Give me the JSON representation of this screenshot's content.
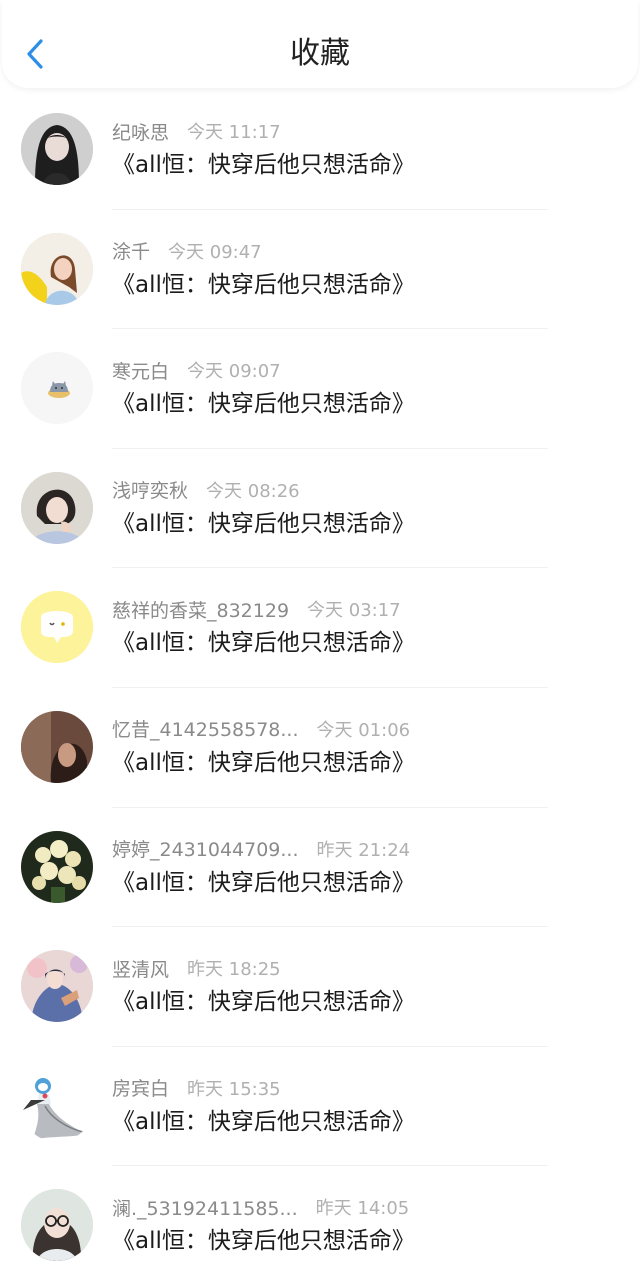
{
  "header": {
    "title": "收藏",
    "back_icon": "chevron-left-icon",
    "accent": "#2d8ee8"
  },
  "items": [
    {
      "name": "纪咏思",
      "time": "今天 11:17",
      "book": "《all恒：快穿后他只想活命》",
      "avatar": "dark-hair-girl-avatar"
    },
    {
      "name": "涂千",
      "time": "今天 09:47",
      "book": "《all恒：快穿后他只想活命》",
      "avatar": "yellow-jacket-girl-avatar"
    },
    {
      "name": "寒元白",
      "time": "今天 09:07",
      "book": "《all恒：快穿后他只想活命》",
      "avatar": "cat-icon-avatar"
    },
    {
      "name": "浅哼奕秋",
      "time": "今天 08:26",
      "book": "《all恒：快穿后他只想活命》",
      "avatar": "girl-photo-avatar"
    },
    {
      "name": "慈祥的香菜_832129",
      "time": "今天 03:17",
      "book": "《all恒：快穿后他只想活命》",
      "avatar": "yellow-chat-bubble-avatar"
    },
    {
      "name": "忆昔_4142558578...",
      "time": "今天 01:06",
      "book": "《all恒：快穿后他只想活命》",
      "avatar": "dim-portrait-avatar"
    },
    {
      "name": "婷婷_2431044709...",
      "time": "昨天 21:24",
      "book": "《all恒：快穿后他只想活命》",
      "avatar": "flower-bouquet-avatar"
    },
    {
      "name": "竖清风",
      "time": "昨天 18:25",
      "book": "《all恒：快穿后他只想活命》",
      "avatar": "anime-illustration-avatar"
    },
    {
      "name": "房宾白",
      "time": "昨天 15:35",
      "book": "《all恒：快穿后他只想活命》",
      "avatar": "gardevoir-avatar"
    },
    {
      "name": "澜._53192411585...",
      "time": "昨天 14:05",
      "book": "《all恒：快穿后他只想活命》",
      "avatar": "glasses-girl-avatar"
    }
  ]
}
